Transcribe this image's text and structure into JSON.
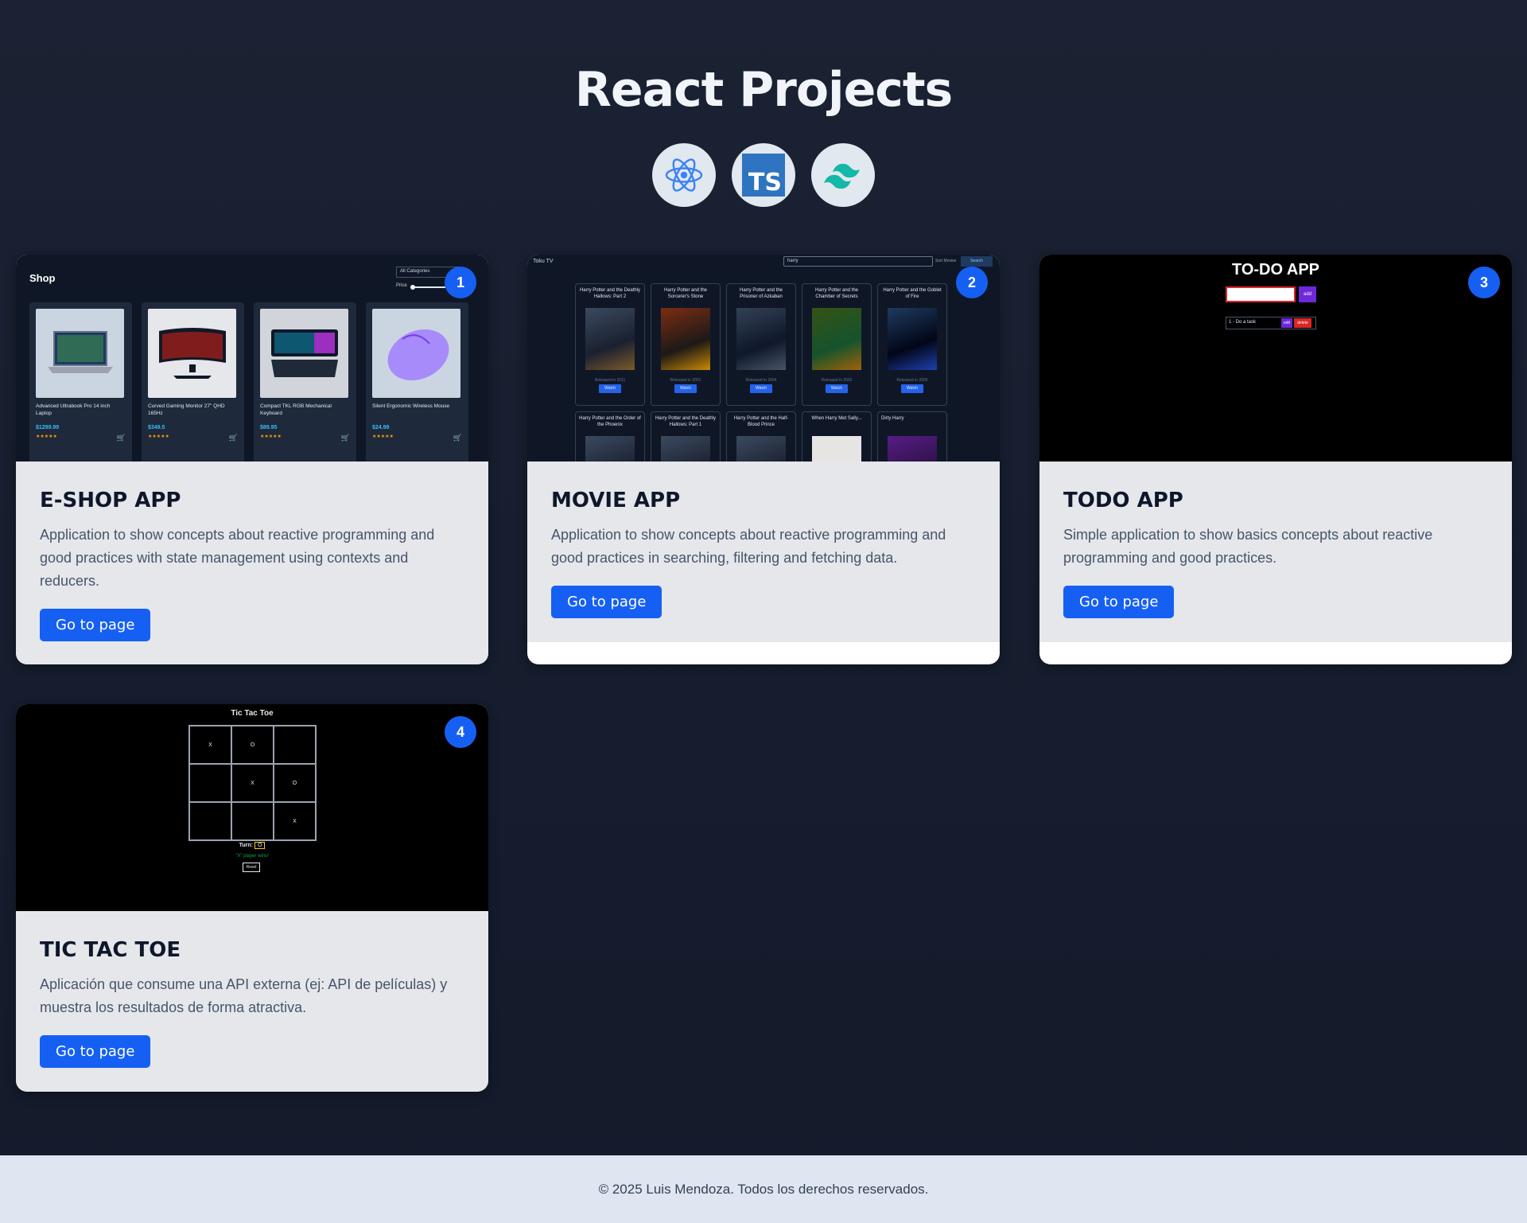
{
  "header": {
    "title": "React Projects",
    "tech_icons": [
      "react-icon",
      "typescript-icon",
      "tailwind-icon"
    ],
    "ts_label": "TS"
  },
  "colors": {
    "background": "#172030",
    "card_body": "#e5e7eb",
    "accent": "#1560f2",
    "footer": "#dfe6f1"
  },
  "projects": [
    {
      "number": "1",
      "title": "E-SHOP APP",
      "description": "Application to show concepts about reactive programming and good practices with state management using contexts and reducers.",
      "button": "Go to page",
      "preview": {
        "heading": "Shop",
        "category_select": "All Categories",
        "price_label": "Price",
        "products": [
          {
            "name": "Advanced Ultrabook Pro 14 inch Laptop",
            "price": "$1299.99"
          },
          {
            "name": "Curved Gaming Monitor 27\" QHD 165Hz",
            "price": "$349.5"
          },
          {
            "name": "Compact TKL RGB Mechanical Keyboard",
            "price": "$89.95"
          },
          {
            "name": "Silent Ergonomic Wireless Mouse",
            "price": "$24.99"
          }
        ]
      }
    },
    {
      "number": "2",
      "title": "MOVIE APP",
      "description": "Application to show concepts about reactive programming and good practices in searching, filtering and fetching data.",
      "button": "Go to page",
      "preview": {
        "brand": "Toku TV",
        "search_value": "harry",
        "sort_label": "Sort Movies",
        "search_button": "Search",
        "watch_label": "Watch",
        "movies": [
          "Harry Potter and the Deathly Hallows: Part 2",
          "Harry Potter and the Sorcerer's Stone",
          "Harry Potter and the Prisoner of Azkaban",
          "Harry Potter and the Chamber of Secrets",
          "Harry Potter and the Goblet of Fire",
          "Harry Potter and the Order of the Phoenix",
          "Harry Potter and the Deathly Hallows: Part 1",
          "Harry Potter and the Half-Blood Prince",
          "When Harry Met Sally...",
          "Dirty Harry"
        ],
        "released": [
          "Released in 2011",
          "Released in 2001",
          "Released in 2004",
          "Released in 2002",
          "Released in 2005"
        ]
      }
    },
    {
      "number": "3",
      "title": "TODO APP",
      "description": "Simple application to show basics concepts about reactive programming and good practices.",
      "button": "Go to page",
      "preview": {
        "heading": "TO-DO APP",
        "add_label": "add",
        "task": "1 - Do a task",
        "edit_label": "edit",
        "delete_label": "delete"
      }
    },
    {
      "number": "4",
      "title": "TIC TAC TOE",
      "description": "Aplicación que consume una API externa (ej: API de películas) y muestra los resultados de forma atractiva.",
      "button": "Go to page",
      "preview": {
        "heading": "Tic Tac Toe",
        "board": [
          "X",
          "O",
          "",
          "",
          "X",
          "O",
          "",
          "",
          "X"
        ],
        "turn_label": "Turn:",
        "turn_value": "O",
        "winner": "\"X\" player wins!",
        "reset": "Reset"
      }
    }
  ],
  "footer": {
    "text": "© 2025 Luis Mendoza. Todos los derechos reservados."
  }
}
